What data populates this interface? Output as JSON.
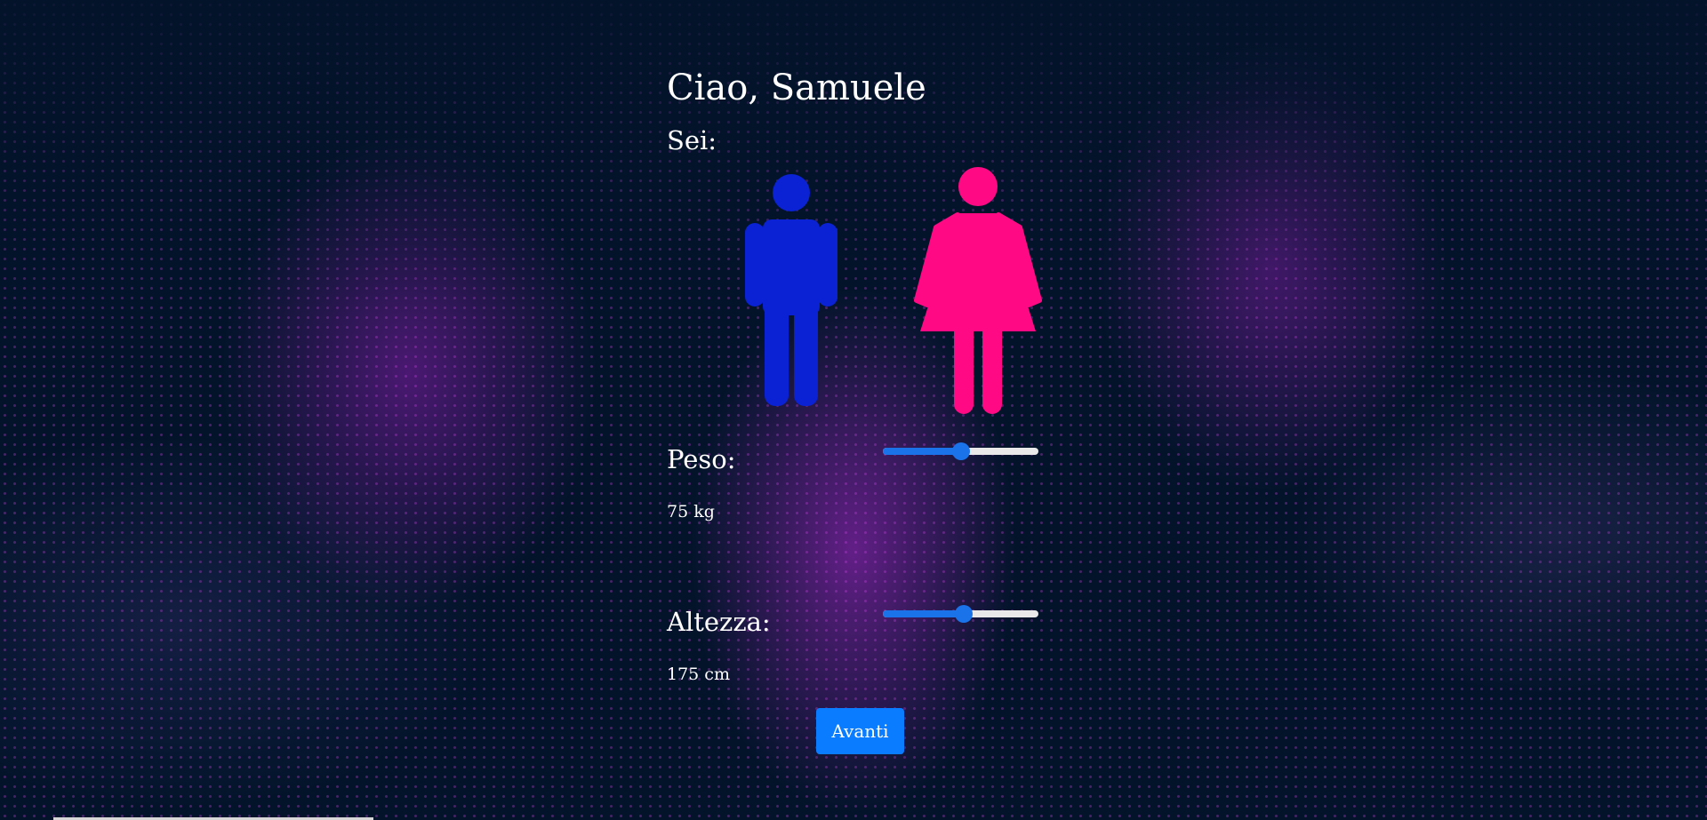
{
  "colors": {
    "background": "#03142a",
    "particle_accent": "#d646eb",
    "male_icon": "#0a22d4",
    "female_icon": "#ff0a84",
    "slider_accent": "#1a73e8",
    "slider_track": "#e9e9ea",
    "button": "#0a7cff"
  },
  "greeting": "Ciao, Samuele",
  "gender": {
    "label": "Sei:",
    "options": [
      {
        "icon": "male-person-icon"
      },
      {
        "icon": "female-person-icon"
      }
    ]
  },
  "weight": {
    "label": "Peso:",
    "value_text": "75 kg",
    "slider_fraction": 0.5
  },
  "height": {
    "label": "Altezza:",
    "value_text": "175 cm",
    "slider_fraction": 0.52
  },
  "submit_label": "Avanti"
}
